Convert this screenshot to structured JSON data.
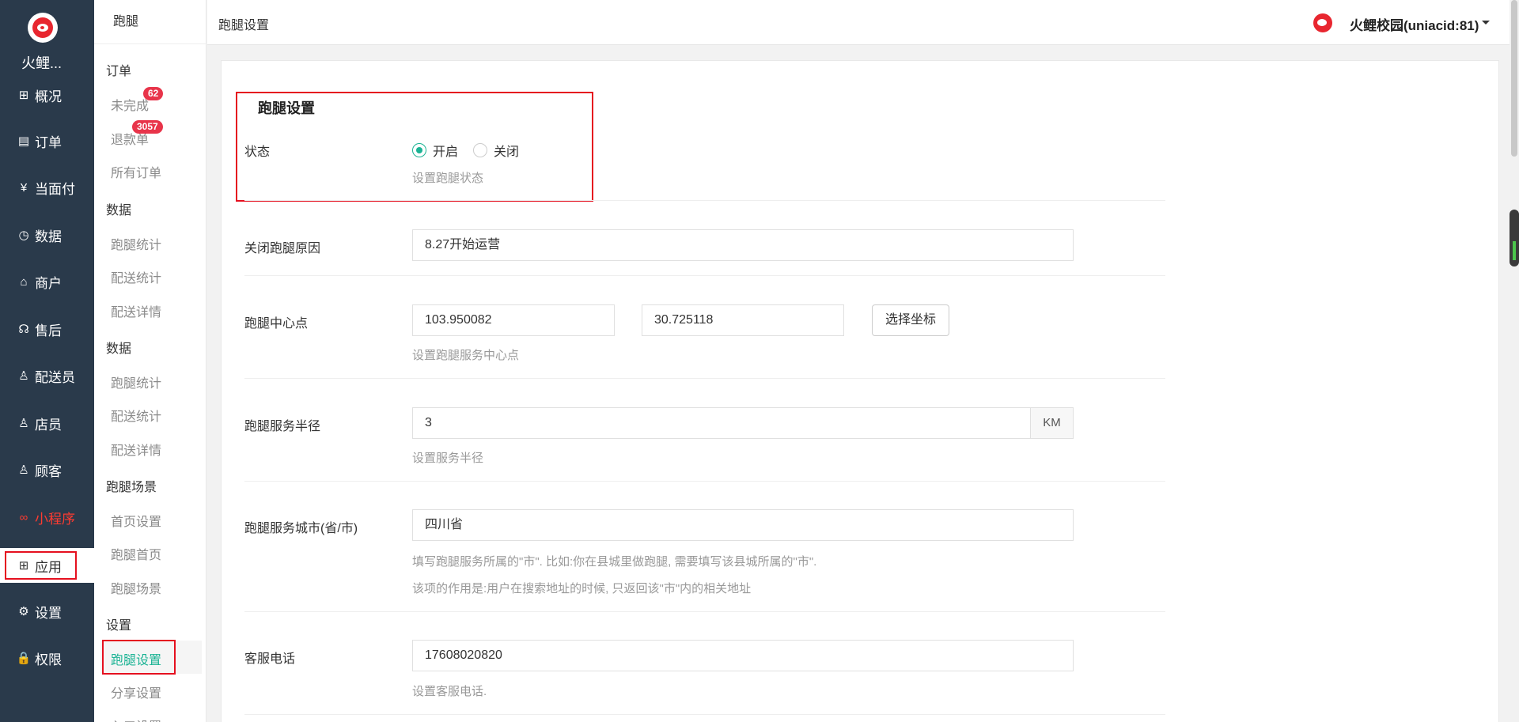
{
  "rail": {
    "brand": "火鲤...",
    "items": [
      {
        "label": "概况",
        "icon": "overview-icon",
        "glyph": "⊞"
      },
      {
        "label": "订单",
        "icon": "order-icon",
        "glyph": "▤"
      },
      {
        "label": "当面付",
        "icon": "yen-icon",
        "glyph": "¥"
      },
      {
        "label": "数据",
        "icon": "chart-icon",
        "glyph": "◷"
      },
      {
        "label": "商户",
        "icon": "store-icon",
        "glyph": "⌂"
      },
      {
        "label": "售后",
        "icon": "headset-icon",
        "glyph": "☊"
      },
      {
        "label": "配送员",
        "icon": "courier-icon",
        "glyph": "♙"
      },
      {
        "label": "店员",
        "icon": "clerk-icon",
        "glyph": "♙"
      },
      {
        "label": "顾客",
        "icon": "customer-icon",
        "glyph": "♙"
      },
      {
        "label": "小程序",
        "icon": "miniprogram-icon",
        "glyph": "∞"
      },
      {
        "label": "应用",
        "icon": "apps-icon",
        "glyph": "⊞"
      },
      {
        "label": "设置",
        "icon": "gear-icon",
        "glyph": "⚙"
      },
      {
        "label": "权限",
        "icon": "lock-icon",
        "glyph": "🔒"
      }
    ]
  },
  "sub": {
    "head": "跑腿",
    "groups": [
      "订单",
      "数据",
      "数据",
      "跑腿场景",
      "设置"
    ],
    "links": [
      "未完成",
      "退款单",
      "所有订单",
      "跑腿统计",
      "配送统计",
      "配送详情",
      "跑腿统计",
      "配送统计",
      "配送详情",
      "首页设置",
      "跑腿首页",
      "跑腿场景",
      "跑腿设置",
      "分享设置",
      "入口设置"
    ],
    "badges": [
      "62",
      "3057"
    ]
  },
  "topbar": {
    "crumb": "跑腿设置",
    "user": "火鲤校园(uniacid:81)"
  },
  "form": {
    "section_title": "跑腿设置",
    "status": {
      "label": "状态",
      "on": "开启",
      "off": "关闭",
      "help": "设置跑腿状态",
      "selected": "开启"
    },
    "close_reason": {
      "label": "关闭跑腿原因",
      "value": "8.27开始运营"
    },
    "center": {
      "label": "跑腿中心点",
      "lng": "103.950082",
      "lat": "30.725118",
      "button": "选择坐标",
      "help": "设置跑腿服务中心点"
    },
    "radius": {
      "label": "跑腿服务半径",
      "value": "3",
      "unit": "KM",
      "help": "设置服务半径"
    },
    "city": {
      "label": "跑腿服务城市(省/市)",
      "value": "四川省",
      "help1": "填写跑腿服务所属的\"市\". 比如:你在县城里做跑腿, 需要填写该县城所属的\"市\".",
      "help2": "该项的作用是:用户在搜索地址的时候, 只返回该\"市\"内的相关地址"
    },
    "phone": {
      "label": "客服电话",
      "value": "17608020820",
      "help": "设置客服电话."
    }
  },
  "colors": {
    "rail_bg": "#2a3a4b",
    "accent": "#1bb394",
    "highlight": "#e5101f",
    "mini_red": "#ff3b30"
  }
}
